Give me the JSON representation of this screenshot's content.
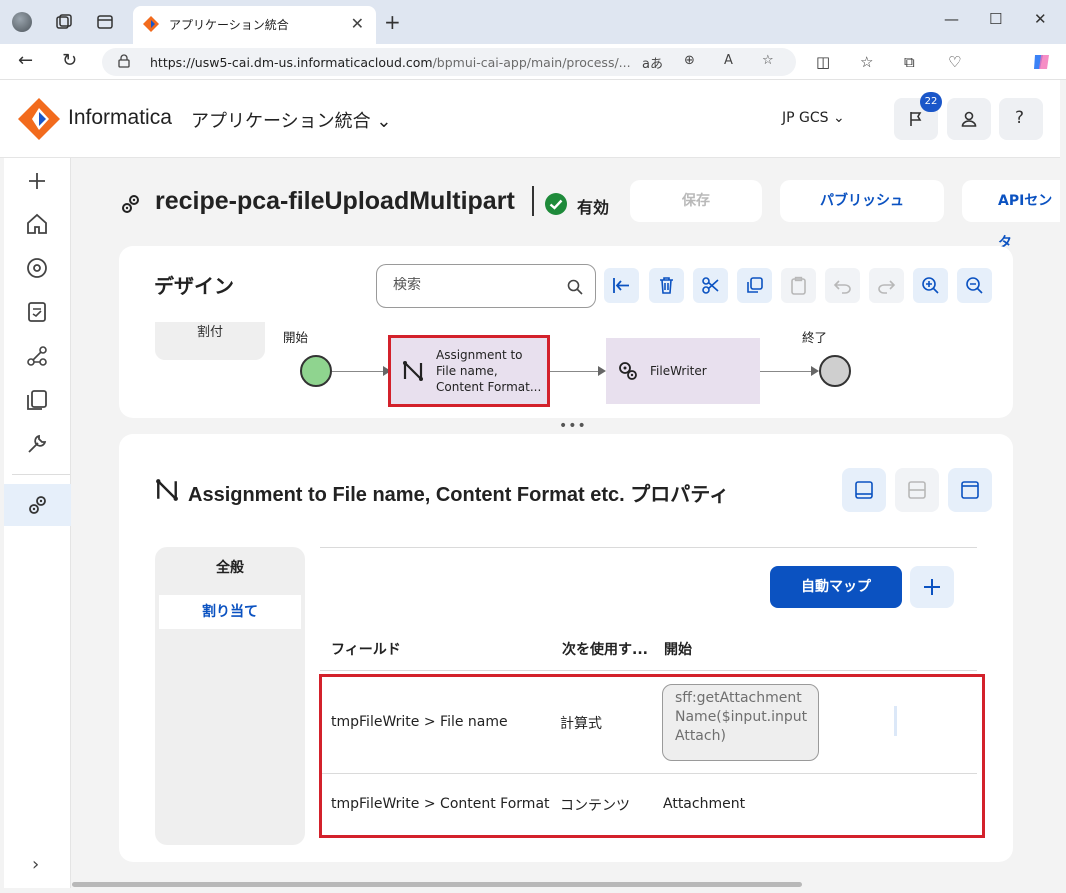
{
  "browser": {
    "tab_title": "アプリケーション統合",
    "url_host": "https://usw5-cai.dm-us.informaticacloud.com",
    "url_path": "/bpmui-cai-app/main/process/...",
    "close_glyph": "✕",
    "new_tab_glyph": "+"
  },
  "header": {
    "brand": "Informatica",
    "app_name": "アプリケーション統合",
    "org": "JP GCS",
    "notification_count": "22",
    "help_glyph": "?"
  },
  "process": {
    "name": "recipe-pca-fileUploadMultipart",
    "status": "有効",
    "save_label": "保存",
    "publish_label": "パブリッシュ",
    "api_center_label": "APIセンタ"
  },
  "design": {
    "title": "デザイン",
    "search_placeholder": "検索",
    "palette_item": "割付",
    "start_label": "開始",
    "end_label": "終了",
    "assignment_step": [
      "Assignment to",
      "File name,",
      "Content Format..."
    ],
    "filewriter_step": "FileWriter",
    "splitter": "•••"
  },
  "properties": {
    "title": "Assignment to File name, Content Format etc. プロパティ",
    "nav_general": "全般",
    "nav_assign": "割り当て",
    "automap_label": "自動マップ",
    "columns": [
      "フィールド",
      "次を使用す...",
      "開始"
    ],
    "rows": [
      {
        "field_prefix": "tmpFileWrite > ",
        "field_name": "File name",
        "use": "計算式",
        "start": "sff:getAttachmentName($input.inputAttach)"
      },
      {
        "field_prefix": "tmpFileWrite > ",
        "field_name": "Content Format",
        "use": "コンテンツ",
        "start": "Attachment"
      }
    ]
  },
  "colors": {
    "accent": "#0b52c1",
    "highlight": "#d3212b",
    "start_node": "#8fd48f",
    "step_fill": "#e8e0ee"
  }
}
